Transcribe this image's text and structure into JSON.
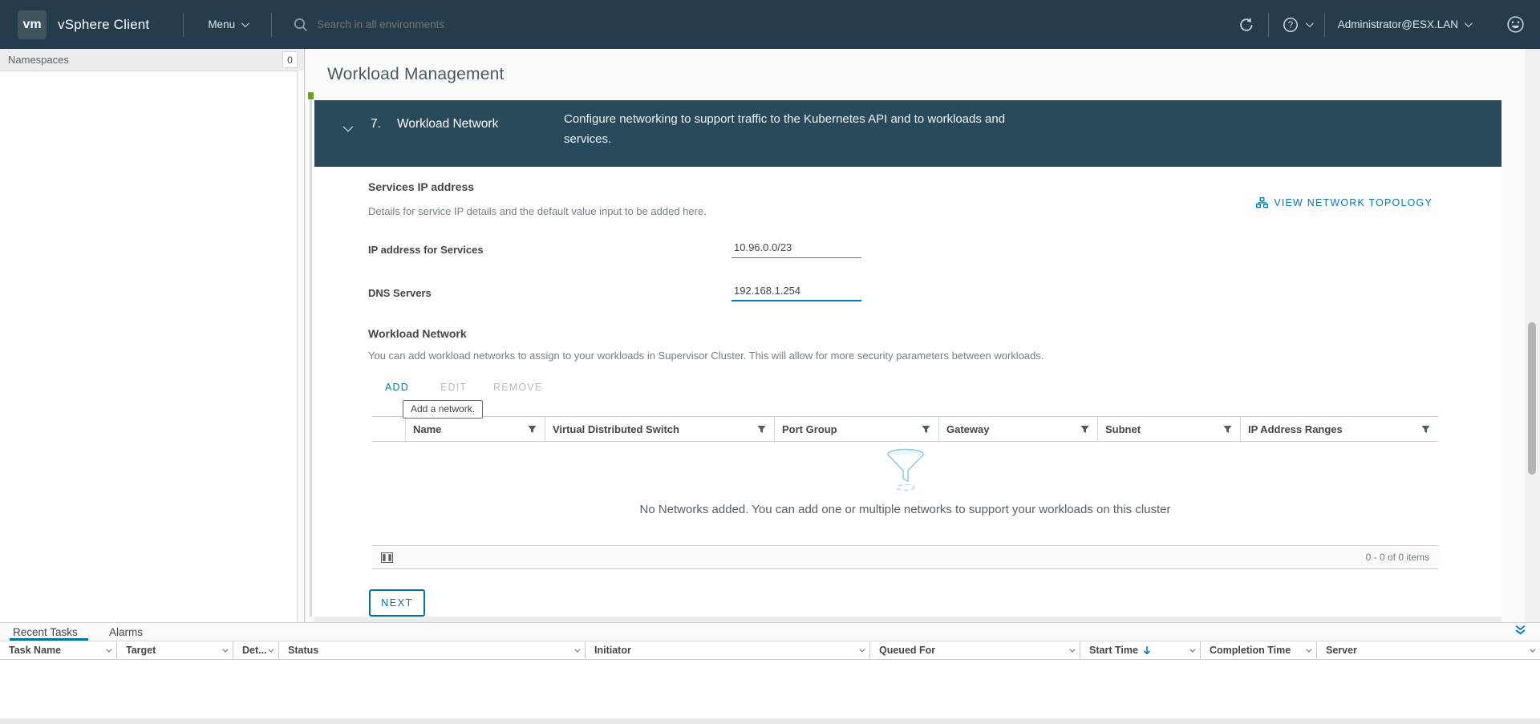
{
  "topbar": {
    "logo_text": "vm",
    "app_title": "vSphere Client",
    "menu_label": "Menu",
    "search_placeholder": "Search in all environments",
    "user_label": "Administrator@ESX.LAN"
  },
  "sidebar": {
    "header_label": "Namespaces",
    "count_badge": "0"
  },
  "page": {
    "title": "Workload Management"
  },
  "wizard": {
    "step_number": "7.",
    "step_title": "Workload Network",
    "step_description_line1": "Configure networking to support traffic to the Kubernetes API and to workloads and",
    "step_description_line2": "services.",
    "services": {
      "heading": "Services IP address",
      "description": "Details for service IP details and the default value input to be added here.",
      "topology_link": "VIEW NETWORK TOPOLOGY",
      "ip_label": "IP address for Services",
      "ip_value": "10.96.0.0/23",
      "dns_label": "DNS Servers",
      "dns_value": "192.168.1.254"
    },
    "network": {
      "heading": "Workload Network",
      "description": "You can add workload networks to assign to your workloads in Supervisor Cluster. This will allow for more security parameters between workloads.",
      "add_label": "ADD",
      "edit_label": "EDIT",
      "remove_label": "REMOVE",
      "tooltip": "Add a network.",
      "columns": [
        "Name",
        "Virtual Distributed Switch",
        "Port Group",
        "Gateway",
        "Subnet",
        "IP Address Ranges"
      ],
      "empty_message": "No Networks added. You can add one or multiple networks to support your workloads on this cluster",
      "items_count": "0 - 0 of 0 items"
    },
    "next_label": "NEXT"
  },
  "tasks_panel": {
    "tab_recent": "Recent Tasks",
    "tab_alarms": "Alarms",
    "columns": [
      "Task Name",
      "Target",
      "Det...",
      "Status",
      "Initiator",
      "Queued For",
      "Start Time",
      "Completion Time",
      "Server"
    ]
  },
  "colors": {
    "accent_blue": "#0079b8",
    "topbar_bg": "#253c4d",
    "step_header_bg": "#294a5b",
    "step_indicator_green": "#62a420",
    "empty_funnel_blue": "#8ec9e2",
    "disabled_gray": "#b5bcc0"
  }
}
